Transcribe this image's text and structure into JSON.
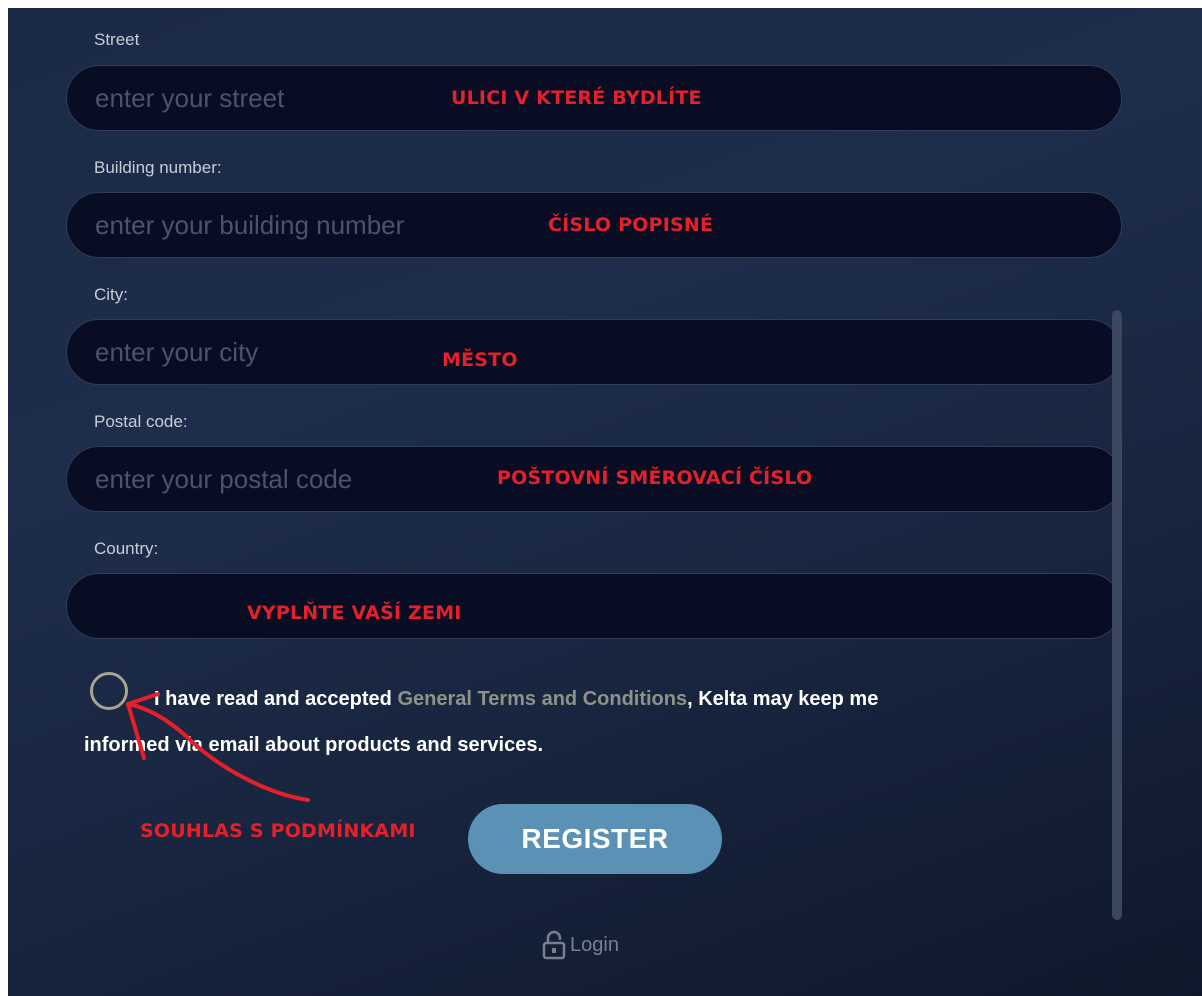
{
  "form": {
    "fields": [
      {
        "label": "Street",
        "placeholder": "enter your street",
        "value": ""
      },
      {
        "label": "Building number:",
        "placeholder": "enter your building number",
        "value": ""
      },
      {
        "label": "City:",
        "placeholder": "enter your city",
        "value": ""
      },
      {
        "label": "Postal code:",
        "placeholder": "enter your postal code",
        "value": ""
      },
      {
        "label": "Country:",
        "placeholder": "",
        "value": ""
      }
    ],
    "consent": {
      "text_before": "I have read and accepted ",
      "link_text": "General Terms and Conditions",
      "text_after": ", Kelta may keep me",
      "text_line2": "informed via email about products and services.",
      "checked": false
    },
    "register_label": "REGISTER",
    "login_label": "Login"
  },
  "annotations": {
    "street": "ULICI V KTERÉ BYDLÍTE",
    "building": "ČÍSLO POPISNÉ",
    "city": "MĚSTO",
    "postal": "POŠTOVNÍ SMĚROVACÍ ČÍSLO",
    "country": "VYPLŇTE VAŠÍ ZEMI",
    "consent": "SOUHLAS S PODMÍNKAMI"
  },
  "colors": {
    "background": "#1b2a45",
    "field_bg": "#080d24",
    "annotation_red": "#e5202a",
    "register_button": "#5b91b5",
    "terms_link": "#8f9288"
  },
  "icons": {
    "login": "lock-icon"
  }
}
